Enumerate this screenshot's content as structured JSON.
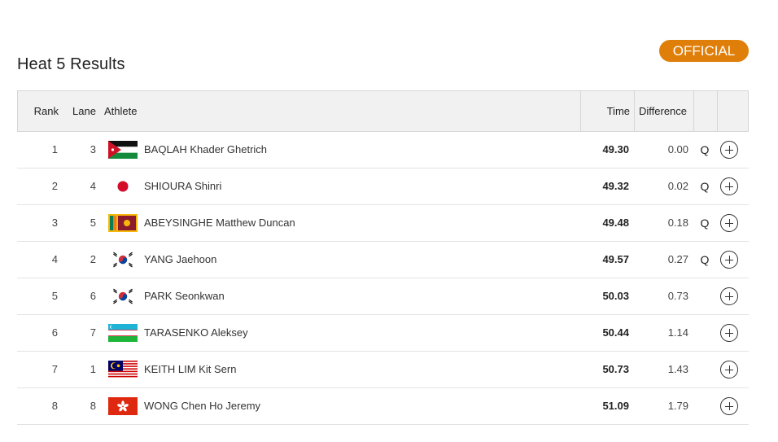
{
  "heat": {
    "title": "Heat 5 Results",
    "status": "OFFICIAL",
    "status_color": "#e07e0a"
  },
  "table": {
    "headers": {
      "rank": "Rank",
      "lane": "Lane",
      "athlete": "Athlete",
      "time": "Time",
      "difference": "Difference"
    },
    "rows": [
      {
        "rank": "1",
        "lane": "3",
        "flag": "jordan-flag",
        "athlete": "BAQLAH Khader Ghetrich",
        "time": "49.30",
        "difference": "0.00",
        "q": "Q"
      },
      {
        "rank": "2",
        "lane": "4",
        "flag": "japan-flag",
        "athlete": "SHIOURA Shinri",
        "time": "49.32",
        "difference": "0.02",
        "q": "Q"
      },
      {
        "rank": "3",
        "lane": "5",
        "flag": "sri-lanka-flag",
        "athlete": "ABEYSINGHE Matthew Duncan",
        "time": "49.48",
        "difference": "0.18",
        "q": "Q"
      },
      {
        "rank": "4",
        "lane": "2",
        "flag": "korea-flag",
        "athlete": "YANG Jaehoon",
        "time": "49.57",
        "difference": "0.27",
        "q": "Q"
      },
      {
        "rank": "5",
        "lane": "6",
        "flag": "korea-flag",
        "athlete": "PARK Seonkwan",
        "time": "50.03",
        "difference": "0.73",
        "q": ""
      },
      {
        "rank": "6",
        "lane": "7",
        "flag": "uzbekistan-flag",
        "athlete": "TARASENKO Aleksey",
        "time": "50.44",
        "difference": "1.14",
        "q": ""
      },
      {
        "rank": "7",
        "lane": "1",
        "flag": "malaysia-flag",
        "athlete": "KEITH LIM Kit Sern",
        "time": "50.73",
        "difference": "1.43",
        "q": ""
      },
      {
        "rank": "8",
        "lane": "8",
        "flag": "hong-kong-flag",
        "athlete": "WONG Chen Ho Jeremy",
        "time": "51.09",
        "difference": "1.79",
        "q": ""
      }
    ]
  }
}
